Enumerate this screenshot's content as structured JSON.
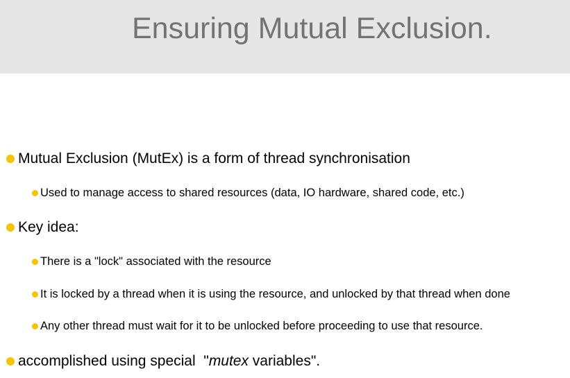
{
  "slide": {
    "title": "Ensuring Mutual Exclusion.",
    "bullets": {
      "b1": "Mutual Exclusion (MutEx) is a form of thread synchronisation",
      "b1a": "Used to manage access to shared resources (data, IO hardware, shared code, etc.)",
      "b2": "Key idea:",
      "b2a": "There is a \"lock\" associated with the resource",
      "b2b": "It is locked by a thread when it is using the resource, and unlocked by that thread when done",
      "b2c": "Any other thread must wait for it to be unlocked before proceeding to use that resource.",
      "b3_pre": "accomplished using special  \"",
      "b3_em": "mutex",
      "b3_post": " variables\"."
    }
  },
  "colors": {
    "title_band": "#e6e6e6",
    "title_text": "#737373",
    "bullet_dot": "#f5c400",
    "body_text": "#000000"
  }
}
